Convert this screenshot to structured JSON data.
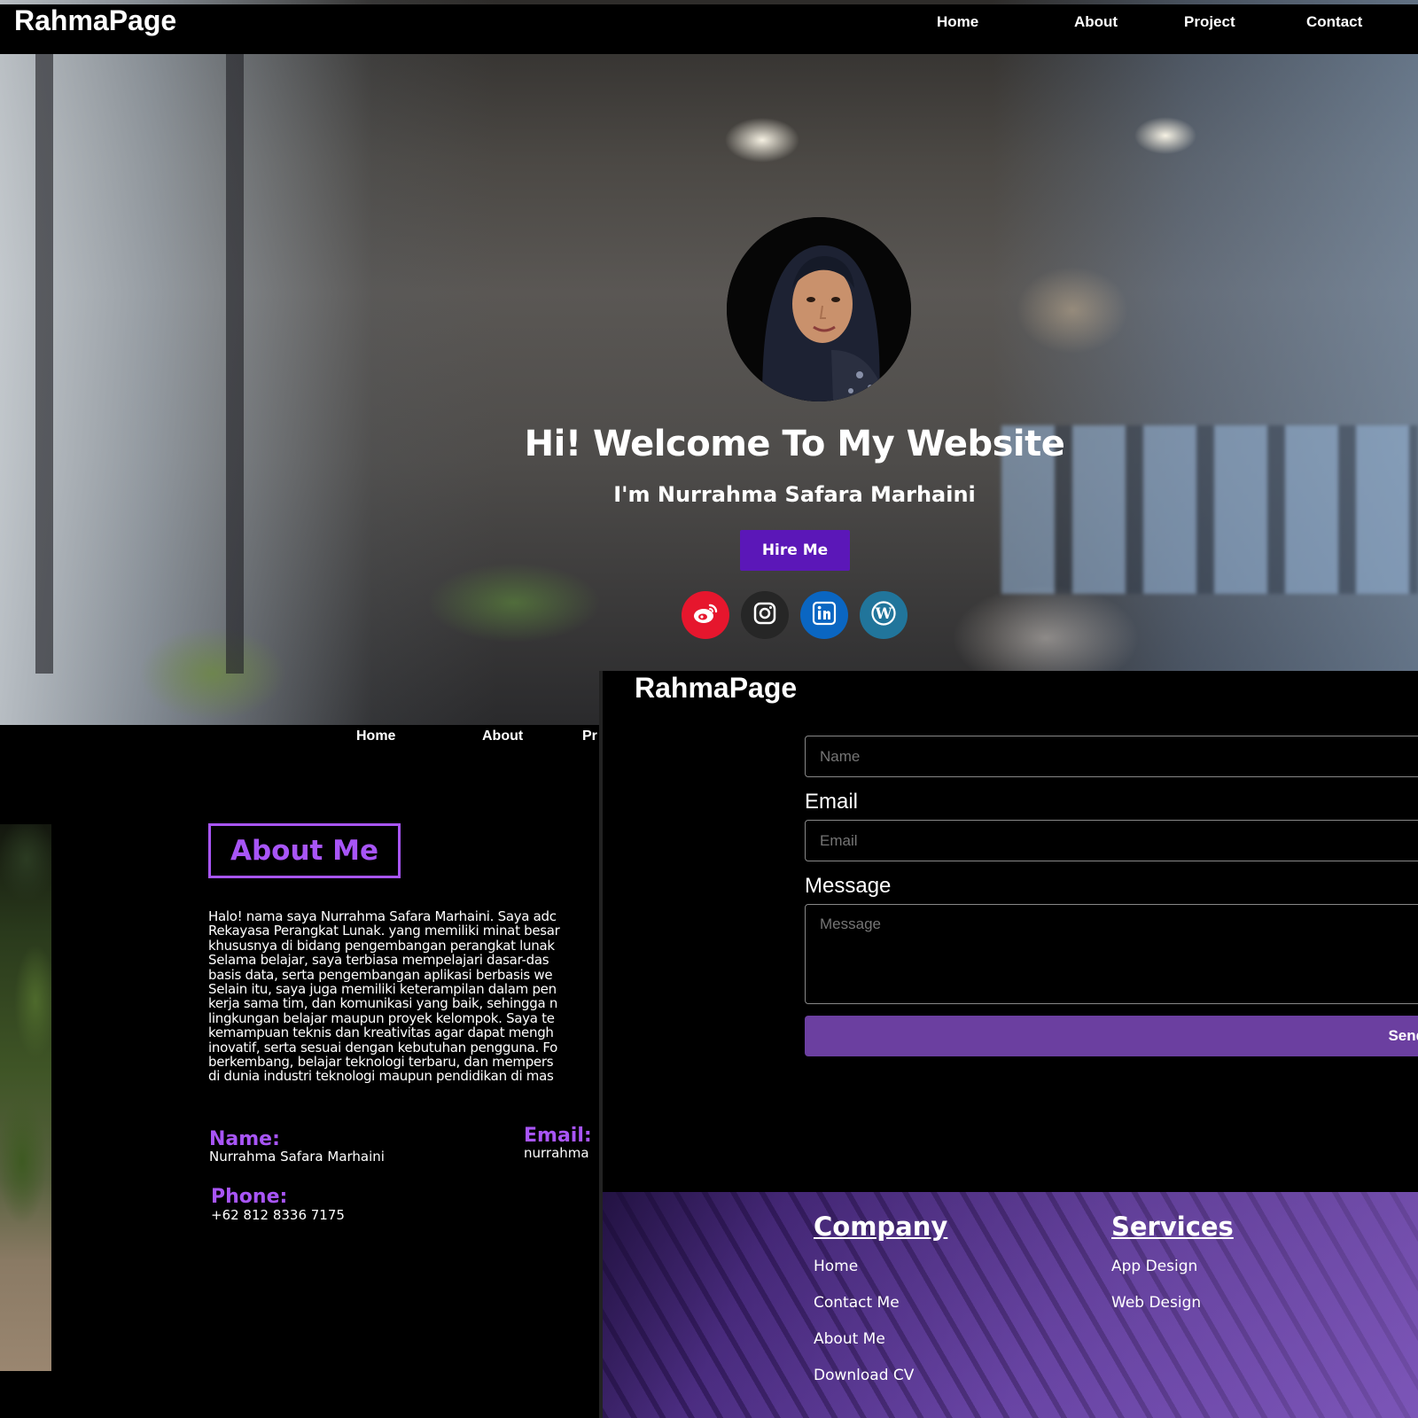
{
  "hero": {
    "brand": "RahmaPage",
    "nav": [
      {
        "label": "Home"
      },
      {
        "label": "About"
      },
      {
        "label": "Project"
      },
      {
        "label": "Contact"
      }
    ],
    "title": "Hi! Welcome To My Website",
    "subtitle": "I'm Nurrahma Safara Marhaini",
    "hire_label": "Hire Me",
    "socials": [
      {
        "icon": "weibo-icon",
        "color": "#e6162d"
      },
      {
        "icon": "instagram-icon",
        "color": "#262626"
      },
      {
        "icon": "linkedin-icon",
        "color": "#0a66c2"
      },
      {
        "icon": "wordpress-icon",
        "color": "#21759b"
      }
    ]
  },
  "about": {
    "nav": [
      {
        "label": "Home"
      },
      {
        "label": "About"
      },
      {
        "label": "Pr"
      }
    ],
    "heading": "About Me",
    "paragraph_lines": [
      "Halo! nama saya Nurrahma Safara Marhaini. Saya adc",
      "Rekayasa Perangkat Lunak. yang memiliki minat besar",
      "khususnya di bidang pengembangan perangkat lunak",
      "Selama belajar, saya terbiasa mempelajari dasar-das",
      "basis data, serta pengembangan aplikasi berbasis we",
      "Selain itu, saya juga memiliki keterampilan dalam pen",
      "kerja sama tim, dan komunikasi yang baik, sehingga n",
      "lingkungan belajar maupun proyek kelompok. Saya te",
      "kemampuan teknis dan kreativitas agar dapat mengh",
      "inovatif, serta sesuai dengan kebutuhan pengguna. Fo",
      "berkembang, belajar teknologi terbaru, dan mempers",
      "di dunia industri teknologi maupun pendidikan di mas"
    ],
    "name_label": "Name:",
    "name_value": "Nurrahma Safara Marhaini",
    "email_label": "Email:",
    "email_value": "nurrahma",
    "phone_label": "Phone:",
    "phone_value": "+62 812 8336 7175"
  },
  "contact": {
    "brand": "RahmaPage",
    "name_placeholder": "Name",
    "email_label": "Email",
    "email_placeholder": "Email",
    "message_label": "Message",
    "message_placeholder": "Message",
    "send_label": "Send",
    "accent": "#6b3fa0"
  },
  "footer": {
    "company_heading": "Company",
    "company_links": [
      {
        "label": "Home"
      },
      {
        "label": "Contact Me"
      },
      {
        "label": "About Me"
      },
      {
        "label": "Download CV"
      }
    ],
    "services_heading": "Services",
    "services_links": [
      {
        "label": "App Design"
      },
      {
        "label": "Web Design"
      }
    ]
  },
  "colors": {
    "accent_purple": "#a855f7",
    "button_purple": "#5b17b8"
  }
}
